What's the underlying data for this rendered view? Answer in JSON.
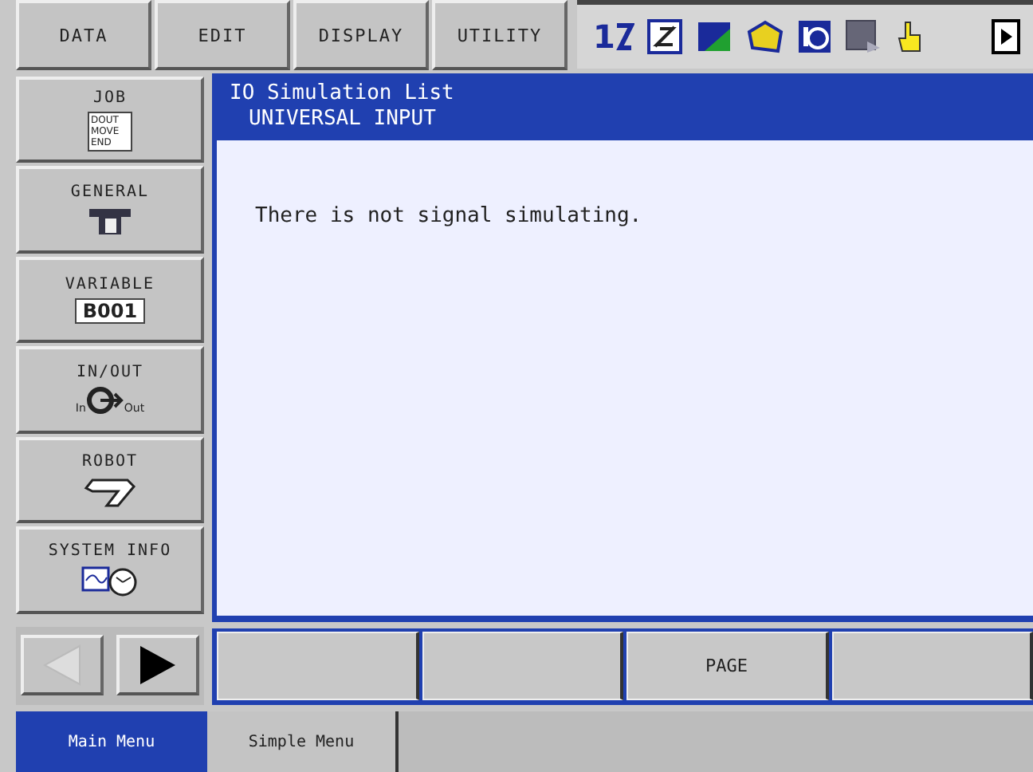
{
  "menu": [
    {
      "label": "DATA"
    },
    {
      "label": "EDIT"
    },
    {
      "label": "DISPLAY"
    },
    {
      "label": "UTILITY"
    }
  ],
  "status_icons": [
    {
      "kind": "numbers",
      "text": "1"
    },
    {
      "kind": "coord"
    },
    {
      "kind": "speed"
    },
    {
      "kind": "mode"
    },
    {
      "kind": "cycle"
    },
    {
      "kind": "page"
    },
    {
      "kind": "hand"
    }
  ],
  "side": [
    {
      "label": "JOB",
      "kind": "job",
      "icon_text": "DOUT MOVE END"
    },
    {
      "label": "GENERAL",
      "kind": "general"
    },
    {
      "label": "VARIABLE",
      "kind": "variable",
      "icon_text": "B001"
    },
    {
      "label": "IN/OUT",
      "kind": "inout",
      "icon_text": "In",
      "icon_text2": "Out"
    },
    {
      "label": "ROBOT",
      "kind": "robot"
    },
    {
      "label": "SYSTEM INFO",
      "kind": "sysinfo"
    }
  ],
  "nav": {
    "back_enabled": false,
    "forward_enabled": true
  },
  "content": {
    "title": "IO Simulation List",
    "subtitle": "UNIVERSAL INPUT",
    "message": "There is not signal simulating."
  },
  "softkeys": [
    {
      "kind": "blank"
    },
    {
      "kind": "blank"
    },
    {
      "kind": "label",
      "label": "PAGE"
    },
    {
      "kind": "blank"
    }
  ],
  "bottom_tabs": [
    {
      "label": "Main Menu",
      "selected": true
    },
    {
      "label": "Simple Menu",
      "selected": false
    }
  ]
}
